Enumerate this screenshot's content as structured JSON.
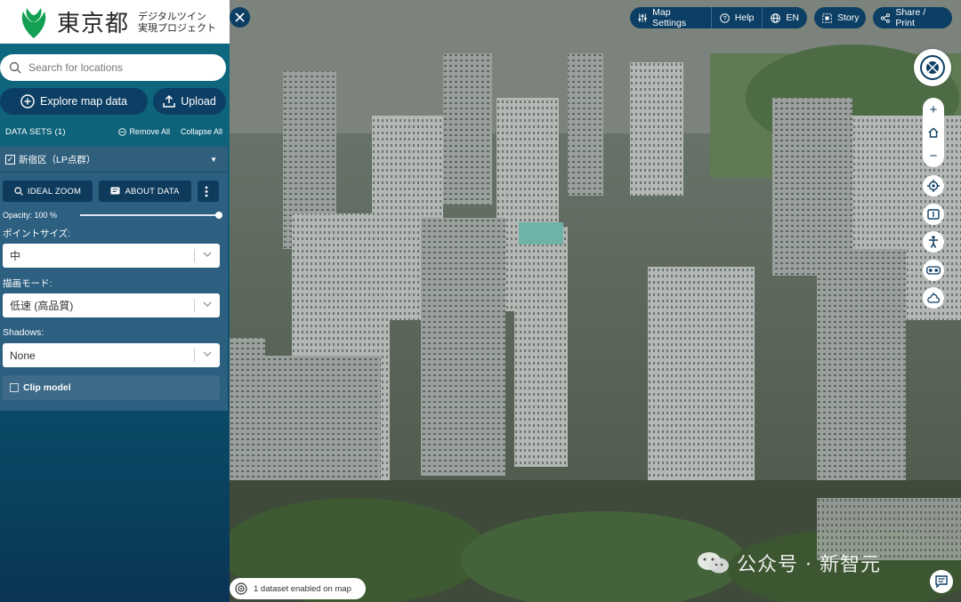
{
  "app": {
    "logo_text": "東京都",
    "logo_sub_line1": "デジタルツイン",
    "logo_sub_line2": "実現プロジェクト"
  },
  "search": {
    "placeholder": "Search for locations"
  },
  "actions": {
    "explore": "Explore map data",
    "upload": "Upload"
  },
  "datasets": {
    "header": "DATA SETS (1)",
    "remove_all": "Remove All",
    "collapse_all": "Collapse All",
    "item": {
      "name": "新宿区（LP点群）",
      "checked": true,
      "ideal_zoom": "IDEAL ZOOM",
      "about_data": "ABOUT DATA",
      "opacity_label": "Opacity: 100 %",
      "opacity_value": 100,
      "point_size_label": "ポイントサイズ:",
      "point_size_value": "中",
      "render_mode_label": "描画モード:",
      "render_mode_value": "低速 (高品質)",
      "shadows_label": "Shadows:",
      "shadows_value": "None",
      "clip_label": "Clip model",
      "clip_checked": false
    }
  },
  "toolbar": {
    "map_settings": "Map Settings",
    "help": "Help",
    "language": "EN",
    "story": "Story",
    "share": "Share / Print"
  },
  "map": {
    "status": "1 dataset enabled on map",
    "watermark": "公众号 · 新智元"
  },
  "colors": {
    "brand_green": "#13a052",
    "panel_dark": "#0c3f63",
    "sidebar_top": "#0f6a80"
  }
}
